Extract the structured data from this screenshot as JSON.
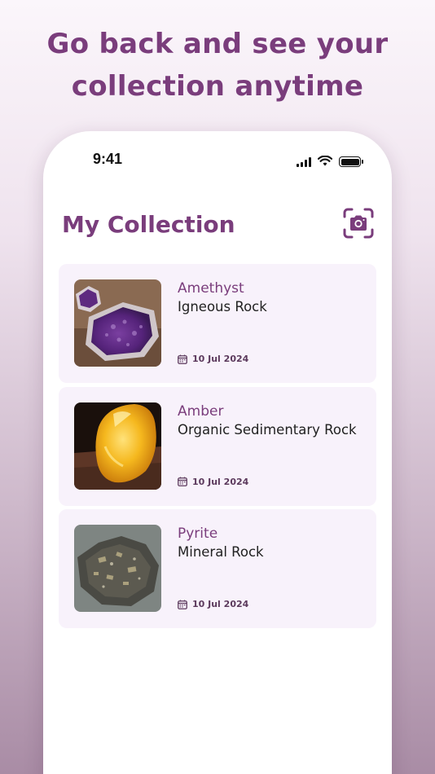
{
  "promo": {
    "headline_line1": "Go back and see your",
    "headline_line2": "collection anytime"
  },
  "status_bar": {
    "time": "9:41",
    "icons": [
      "signal-icon",
      "wifi-icon",
      "battery-icon"
    ]
  },
  "header": {
    "title": "My Collection",
    "action_icon": "camera-scan-icon"
  },
  "collection": [
    {
      "name": "Amethyst",
      "type": "Igneous Rock",
      "date": "10 Jul 2024",
      "image": "amethyst-photo"
    },
    {
      "name": "Amber",
      "type": "Organic Sedimentary Rock",
      "date": "10 Jul 2024",
      "image": "amber-photo"
    },
    {
      "name": "Pyrite",
      "type": "Mineral Rock",
      "date": "10 Jul 2024",
      "image": "pyrite-photo"
    }
  ],
  "colors": {
    "accent": "#7a3d7c",
    "card_background": "#f8f2fb",
    "text_primary": "#222222"
  }
}
